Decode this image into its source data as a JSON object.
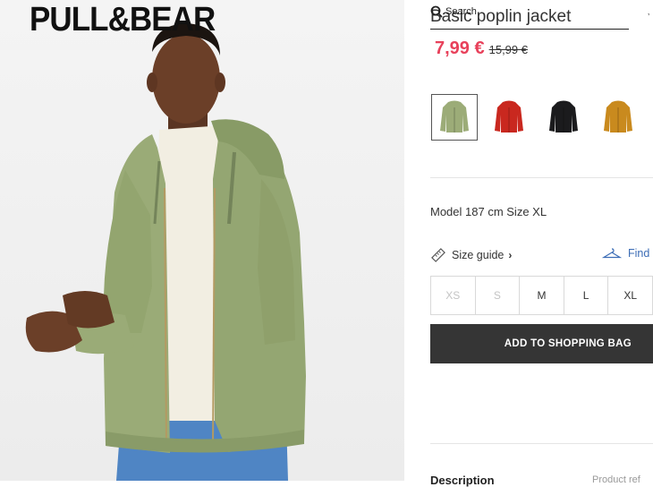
{
  "brand": {
    "logo_text": "PULL&BEAR"
  },
  "header": {
    "search_label": "Search",
    "corner_mark": "’"
  },
  "product": {
    "title": "Basic poplin jacket",
    "price_current": "7,99 €",
    "price_original": "15,99 €",
    "colors": [
      {
        "name": "khaki",
        "hex": "#9cac78",
        "selected": true
      },
      {
        "name": "red",
        "hex": "#c9281f",
        "selected": false
      },
      {
        "name": "black",
        "hex": "#1b1b1d",
        "selected": false
      },
      {
        "name": "mustard",
        "hex": "#c98a1e",
        "selected": false
      }
    ],
    "model_info": "Model 187 cm Size XL",
    "size_guide_label": "Size guide",
    "find_label": "Find",
    "sizes": [
      {
        "label": "XS",
        "available": false
      },
      {
        "label": "S",
        "available": false
      },
      {
        "label": "M",
        "available": true
      },
      {
        "label": "L",
        "available": true
      },
      {
        "label": "XL",
        "available": true
      }
    ],
    "add_to_bag_label": "ADD TO SHOPPING BAG",
    "description_label": "Description",
    "product_ref_label": "Product ref"
  },
  "colors": {
    "price_accent": "#e8415b",
    "button_bg": "#353535",
    "find_link": "#3c6db6"
  }
}
